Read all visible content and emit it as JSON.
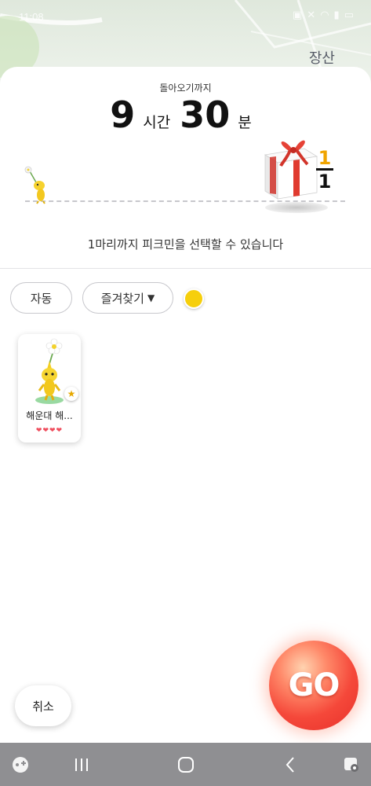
{
  "status_bar": {
    "time": "11:08",
    "icons": [
      "gamepad-icon",
      "mute-icon",
      "wifi-icon",
      "signal-icon",
      "battery-icon"
    ]
  },
  "map": {
    "place_label": "장산"
  },
  "timer": {
    "label": "돌아오기까지",
    "hours": "9",
    "hours_unit": "시간",
    "minutes": "30",
    "minutes_unit": "분"
  },
  "progress": {
    "count_selected": "1",
    "count_max": "1"
  },
  "hint": "1마리까지 피크민을 선택할 수 있습니다",
  "filters": {
    "auto_label": "자동",
    "favorite_label": "즐겨찾기",
    "favorite_arrow": "▼",
    "color_filter": "#f6cf0c"
  },
  "pikmin_list": [
    {
      "name": "해운대 해...",
      "hearts": "❤❤❤❤",
      "color": "yellow"
    }
  ],
  "actions": {
    "cancel_label": "취소",
    "go_label": "GO"
  },
  "navbar": {
    "icons": [
      "game-launcher-icon",
      "recent-apps-icon",
      "home-icon",
      "back-icon",
      "assistant-icon"
    ]
  }
}
